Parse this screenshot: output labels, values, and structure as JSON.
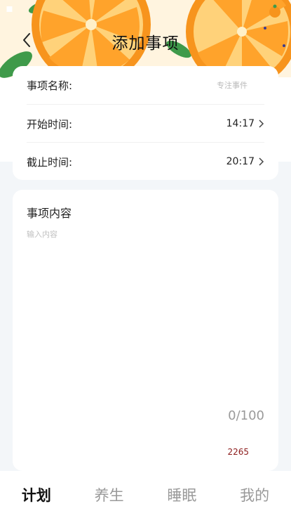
{
  "nav": {
    "title": "添加事项",
    "back_icon": "chevron-left-icon"
  },
  "form": {
    "name_label": "事项名称:",
    "name_placeholder": "专注事件",
    "start_label": "开始时间:",
    "start_value": "14:17",
    "end_label": "截止时间:",
    "end_value": "20:17"
  },
  "content": {
    "title": "事项内容",
    "placeholder": "输入内容",
    "counter": "0/100",
    "code": "2265"
  },
  "tabs": [
    {
      "label": "计划",
      "active": true
    },
    {
      "label": "养生",
      "active": false
    },
    {
      "label": "睡眠",
      "active": false
    },
    {
      "label": "我的",
      "active": false
    }
  ],
  "colors": {
    "orange": "#f7941d",
    "leaf": "#3f9a4a",
    "accent_code": "#8b1a1a"
  }
}
